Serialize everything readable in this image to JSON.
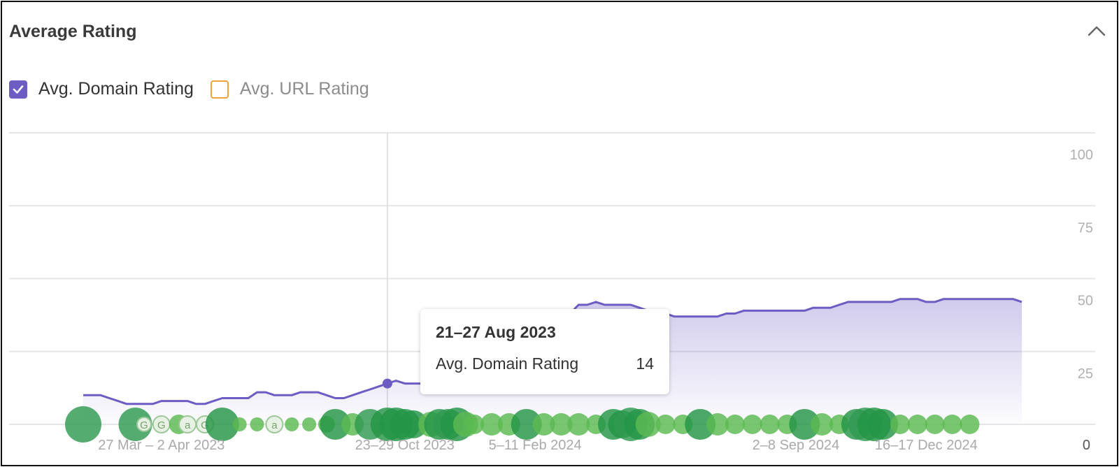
{
  "header": {
    "title": "Average Rating",
    "collapse_icon": "chevron-up-icon"
  },
  "legend": [
    {
      "label": "Avg. Domain Rating",
      "checked": true,
      "color": "#6c5cc4"
    },
    {
      "label": "Avg. URL Rating",
      "checked": false,
      "color": "#f0a33a"
    }
  ],
  "tooltip": {
    "date": "21–27 Aug 2023",
    "label": "Avg. Domain Rating",
    "value": "14"
  },
  "chart_data": {
    "type": "area",
    "ylim": [
      0,
      100
    ],
    "y_ticks": [
      "100",
      "75",
      "50",
      "25",
      "0"
    ],
    "grid": true,
    "x_tick_labels": [
      "27 Mar – 2 Apr 2023",
      "23–29 Oct 2023",
      "5–11 Feb 2024",
      "2–8 Sep 2024",
      "16–17 Dec 2024"
    ],
    "x_tick_index": [
      9,
      37,
      52,
      82,
      97
    ],
    "series": [
      {
        "name": "Avg. Domain Rating",
        "color": "#6c5cc4",
        "values": [
          10,
          10,
          10,
          9,
          8,
          7,
          7,
          7,
          7,
          8,
          8,
          8,
          8,
          7,
          7,
          8,
          9,
          9,
          9,
          9,
          11,
          11,
          10,
          10,
          10,
          11,
          11,
          11,
          10,
          9,
          9,
          10,
          11,
          12,
          13,
          14,
          15,
          14,
          14,
          14,
          14,
          15,
          15,
          15,
          16,
          16,
          16,
          17,
          17,
          17,
          18,
          19,
          20,
          24,
          28,
          34,
          38,
          41,
          41,
          42,
          41,
          41,
          41,
          41,
          40,
          39,
          38,
          38,
          37,
          37,
          37,
          37,
          37,
          37,
          38,
          38,
          39,
          39,
          39,
          39,
          39,
          39,
          39,
          39,
          40,
          40,
          40,
          41,
          42,
          42,
          42,
          42,
          42,
          42,
          43,
          43,
          43,
          42,
          42,
          43,
          43,
          43,
          43,
          43,
          43,
          43,
          43,
          43,
          42
        ],
        "highlight_index": 35
      }
    ],
    "events": [
      {
        "i": 0,
        "r": 26,
        "shade": 0
      },
      {
        "i": 6,
        "r": 24,
        "shade": 0
      },
      {
        "i": 7,
        "r": 10,
        "shade": 3,
        "mark": "G"
      },
      {
        "i": 9,
        "r": 12,
        "shade": 3,
        "mark": "G"
      },
      {
        "i": 11,
        "r": 14,
        "shade": 2
      },
      {
        "i": 12,
        "r": 12,
        "shade": 3,
        "mark": "a"
      },
      {
        "i": 14,
        "r": 12,
        "shade": 3,
        "mark": "G"
      },
      {
        "i": 16,
        "r": 24,
        "shade": 1
      },
      {
        "i": 18,
        "r": 10,
        "shade": 2
      },
      {
        "i": 20,
        "r": 10,
        "shade": 2
      },
      {
        "i": 22,
        "r": 12,
        "shade": 3,
        "mark": "a"
      },
      {
        "i": 24,
        "r": 10,
        "shade": 2
      },
      {
        "i": 26,
        "r": 10,
        "shade": 2
      },
      {
        "i": 28,
        "r": 12,
        "shade": 2
      },
      {
        "i": 29,
        "r": 22,
        "shade": 1
      },
      {
        "i": 31,
        "r": 16,
        "shade": 2
      },
      {
        "i": 33,
        "r": 22,
        "shade": 0
      },
      {
        "i": 35,
        "r": 24,
        "shade": 1
      },
      {
        "i": 36,
        "r": 24,
        "shade": 1
      },
      {
        "i": 37,
        "r": 22,
        "shade": 1
      },
      {
        "i": 38,
        "r": 20,
        "shade": 1
      },
      {
        "i": 40,
        "r": 18,
        "shade": 2
      },
      {
        "i": 41,
        "r": 22,
        "shade": 1
      },
      {
        "i": 42,
        "r": 22,
        "shade": 0
      },
      {
        "i": 43,
        "r": 24,
        "shade": 1
      },
      {
        "i": 44,
        "r": 18,
        "shade": 2
      },
      {
        "i": 45,
        "r": 14,
        "shade": 2
      },
      {
        "i": 47,
        "r": 16,
        "shade": 2
      },
      {
        "i": 49,
        "r": 16,
        "shade": 2
      },
      {
        "i": 51,
        "r": 22,
        "shade": 1
      },
      {
        "i": 53,
        "r": 16,
        "shade": 2
      },
      {
        "i": 55,
        "r": 16,
        "shade": 2
      },
      {
        "i": 57,
        "r": 16,
        "shade": 2
      },
      {
        "i": 59,
        "r": 14,
        "shade": 2
      },
      {
        "i": 61,
        "r": 22,
        "shade": 1
      },
      {
        "i": 62,
        "r": 20,
        "shade": 1
      },
      {
        "i": 63,
        "r": 24,
        "shade": 0
      },
      {
        "i": 64,
        "r": 22,
        "shade": 1
      },
      {
        "i": 65,
        "r": 18,
        "shade": 2
      },
      {
        "i": 67,
        "r": 14,
        "shade": 2
      },
      {
        "i": 69,
        "r": 14,
        "shade": 2
      },
      {
        "i": 71,
        "r": 22,
        "shade": 1
      },
      {
        "i": 73,
        "r": 16,
        "shade": 2
      },
      {
        "i": 75,
        "r": 14,
        "shade": 2
      },
      {
        "i": 77,
        "r": 14,
        "shade": 2
      },
      {
        "i": 79,
        "r": 14,
        "shade": 2
      },
      {
        "i": 81,
        "r": 14,
        "shade": 2
      },
      {
        "i": 83,
        "r": 22,
        "shade": 1
      },
      {
        "i": 85,
        "r": 16,
        "shade": 2
      },
      {
        "i": 87,
        "r": 14,
        "shade": 2
      },
      {
        "i": 89,
        "r": 22,
        "shade": 1
      },
      {
        "i": 90,
        "r": 24,
        "shade": 0
      },
      {
        "i": 91,
        "r": 24,
        "shade": 1
      },
      {
        "i": 92,
        "r": 22,
        "shade": 1
      },
      {
        "i": 94,
        "r": 14,
        "shade": 2
      },
      {
        "i": 96,
        "r": 14,
        "shade": 2
      },
      {
        "i": 98,
        "r": 14,
        "shade": 2
      },
      {
        "i": 100,
        "r": 14,
        "shade": 2
      },
      {
        "i": 102,
        "r": 14,
        "shade": 2
      }
    ],
    "event_colors": [
      "#2f9a50",
      "#239546",
      "#5cba52",
      "#e8f2e4"
    ]
  }
}
